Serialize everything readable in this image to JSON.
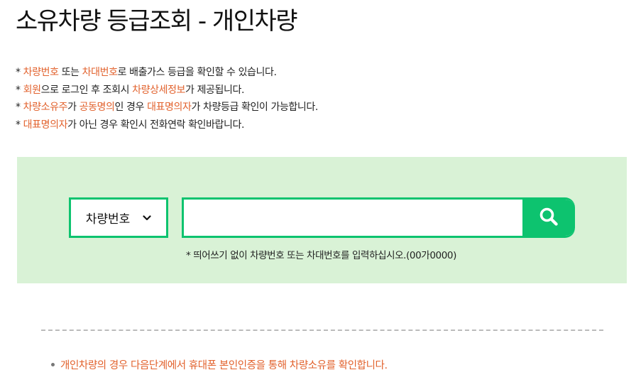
{
  "page": {
    "title": "소유차량 등급조회 - 개인차량"
  },
  "notices": [
    {
      "bullet": "* ",
      "parts": [
        {
          "text": "차량번호",
          "hl": true
        },
        {
          "text": " 또는 ",
          "hl": false
        },
        {
          "text": "차대번호",
          "hl": true
        },
        {
          "text": "로 배출가스 등급을 확인할 수 있습니다.",
          "hl": false
        }
      ]
    },
    {
      "bullet": "* ",
      "parts": [
        {
          "text": "회원",
          "hl": true
        },
        {
          "text": "으로 로그인 후 조회시 ",
          "hl": false
        },
        {
          "text": "차량상세정보",
          "hl": true
        },
        {
          "text": "가 제공됩니다.",
          "hl": false
        }
      ]
    },
    {
      "bullet": "* ",
      "parts": [
        {
          "text": "차량소유주",
          "hl": true
        },
        {
          "text": "가 ",
          "hl": false
        },
        {
          "text": "공동명의",
          "hl": true
        },
        {
          "text": "인 경우 ",
          "hl": false
        },
        {
          "text": "대표명의자",
          "hl": true
        },
        {
          "text": "가 차량등급 확인이 가능합니다.",
          "hl": false
        }
      ]
    },
    {
      "bullet": "* ",
      "parts": [
        {
          "text": "대표명의자",
          "hl": true
        },
        {
          "text": "가 아닌 경우 확인시 전화연락 확인바랍니다.",
          "hl": false
        }
      ]
    }
  ],
  "search": {
    "type_selected": "차량번호",
    "input_value": "",
    "input_placeholder": "",
    "button_icon": "search-icon",
    "hint": "* 띄어쓰기 없이 차량번호 또는 차대번호를 입력하십시오.(00가0000)"
  },
  "bottom_note": "개인차량의 경우 다음단계에서 휴대폰 본인인증을 통해 차량소유를 확인합니다.",
  "colors": {
    "accent": "#0dc36f",
    "highlight": "#e2622d",
    "panel_bg": "#d9f2d6"
  }
}
